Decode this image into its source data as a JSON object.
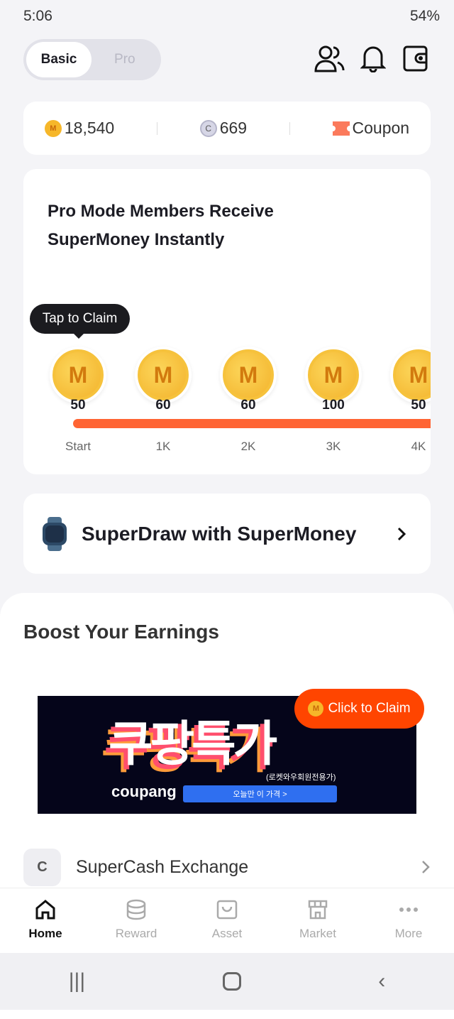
{
  "status": {
    "time": "5:06",
    "battery": "54%"
  },
  "mode": {
    "options": [
      "Basic",
      "Pro"
    ],
    "selected": "Basic"
  },
  "header_icons": [
    "friends-icon",
    "bell-icon",
    "wallet-icon"
  ],
  "balance": {
    "supermoney": "18,540",
    "supercash": "669",
    "coupon": "Coupon"
  },
  "pro": {
    "title": "Pro Mode Members Receive SuperMoney Instantly",
    "tooltip": "Tap to Claim",
    "milestones": [
      {
        "value": "50",
        "label": "Start"
      },
      {
        "value": "60",
        "label": "1K"
      },
      {
        "value": "60",
        "label": "2K"
      },
      {
        "value": "100",
        "label": "3K"
      },
      {
        "value": "50",
        "label": "4K"
      }
    ],
    "coin_letter": "M"
  },
  "superdraw": {
    "label": "SuperDraw with SuperMoney"
  },
  "boost": {
    "title": "Boost Your Earnings",
    "claim": "Click to Claim",
    "banner": {
      "headline": "쿠팡특가",
      "sub": "(로켓와우회원전용가)",
      "brand": "coupang",
      "cta": "오늘만 이 가격 >"
    }
  },
  "exchange": {
    "label": "SuperCash Exchange"
  },
  "nav": [
    {
      "label": "Home",
      "icon": "home-icon"
    },
    {
      "label": "Reward",
      "icon": "coins-icon"
    },
    {
      "label": "Asset",
      "icon": "asset-icon"
    },
    {
      "label": "Market",
      "icon": "store-icon"
    },
    {
      "label": "More",
      "icon": "more-icon"
    }
  ],
  "colors": {
    "accent": "#ff6433",
    "claim": "#ff4500",
    "coin": "#f6b72a"
  }
}
